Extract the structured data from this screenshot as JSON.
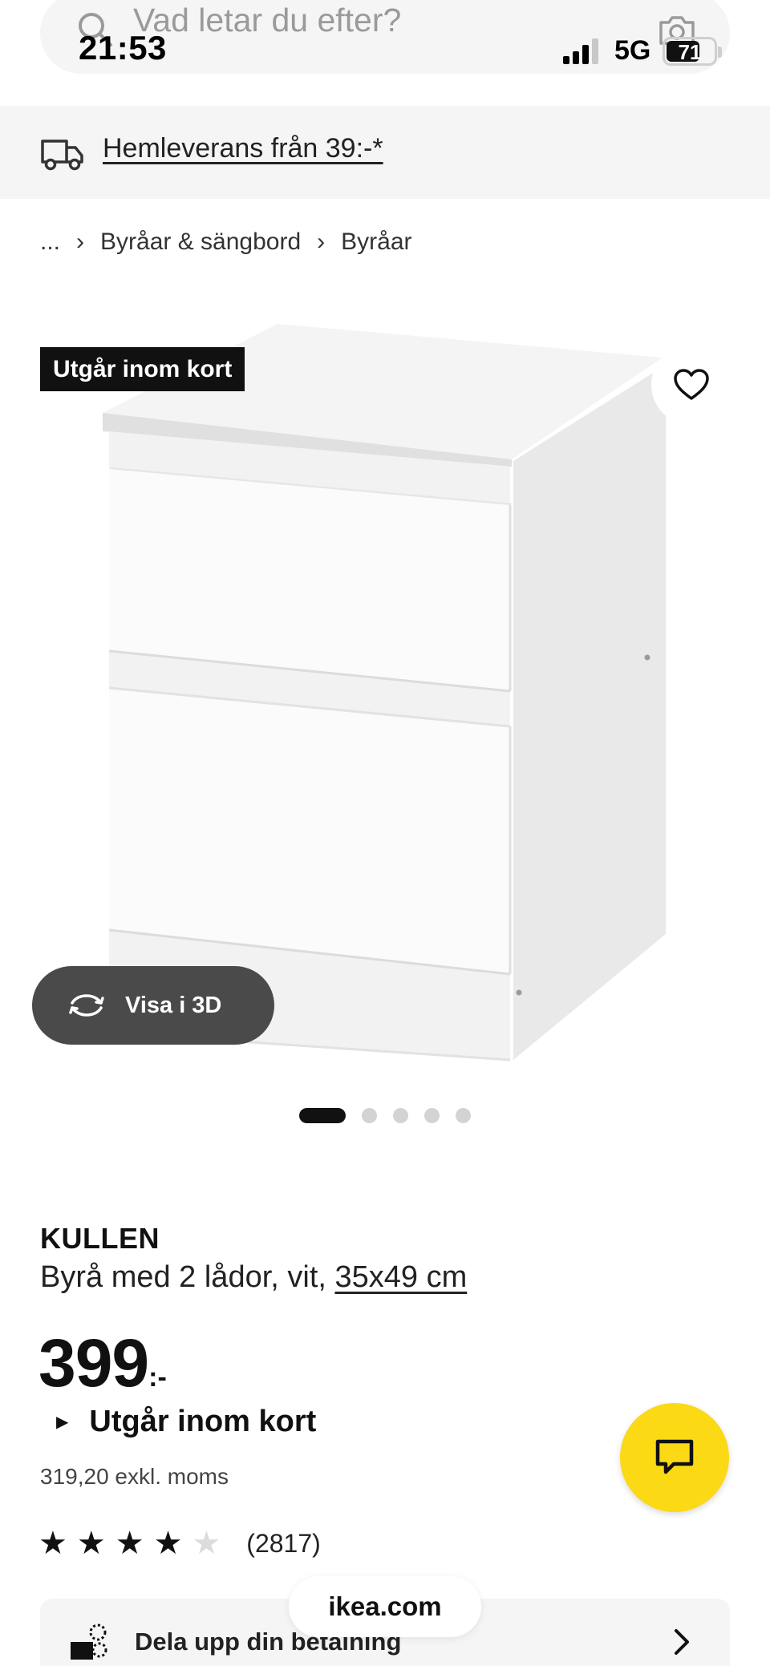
{
  "status_bar": {
    "time": "21:53",
    "network": "5G",
    "battery": "71",
    "battery_level": 0.71
  },
  "search": {
    "placeholder": "Vad letar du efter?"
  },
  "delivery_banner": {
    "text": "Hemleverans från 39:-*"
  },
  "breadcrumb": {
    "ellipsis": "...",
    "items": [
      "Byråar & sängbord",
      "Byråar"
    ]
  },
  "product_image": {
    "status_tag": "Utgår inom kort",
    "view_3d_label": "Visa i 3D",
    "carousel_count": 5,
    "carousel_active": 0
  },
  "product": {
    "name": "KULLEN",
    "description": "Byrå med 2 lådor, vit,",
    "size": "35x49 cm",
    "price": "399",
    "price_suffix": ":-",
    "availability": "Utgår inom kort",
    "price_excl_vat": "319,20 exkl. moms",
    "rating": 4,
    "rating_max": 5,
    "review_count": "(2817)"
  },
  "payment": {
    "label": "Dela upp din betalning"
  },
  "browser": {
    "url": "ikea.com"
  },
  "colors": {
    "brand_yellow": "#fbd914",
    "tag_black": "#111111",
    "surface_grey": "#f5f5f5",
    "button_dark": "#4a4a4a"
  }
}
